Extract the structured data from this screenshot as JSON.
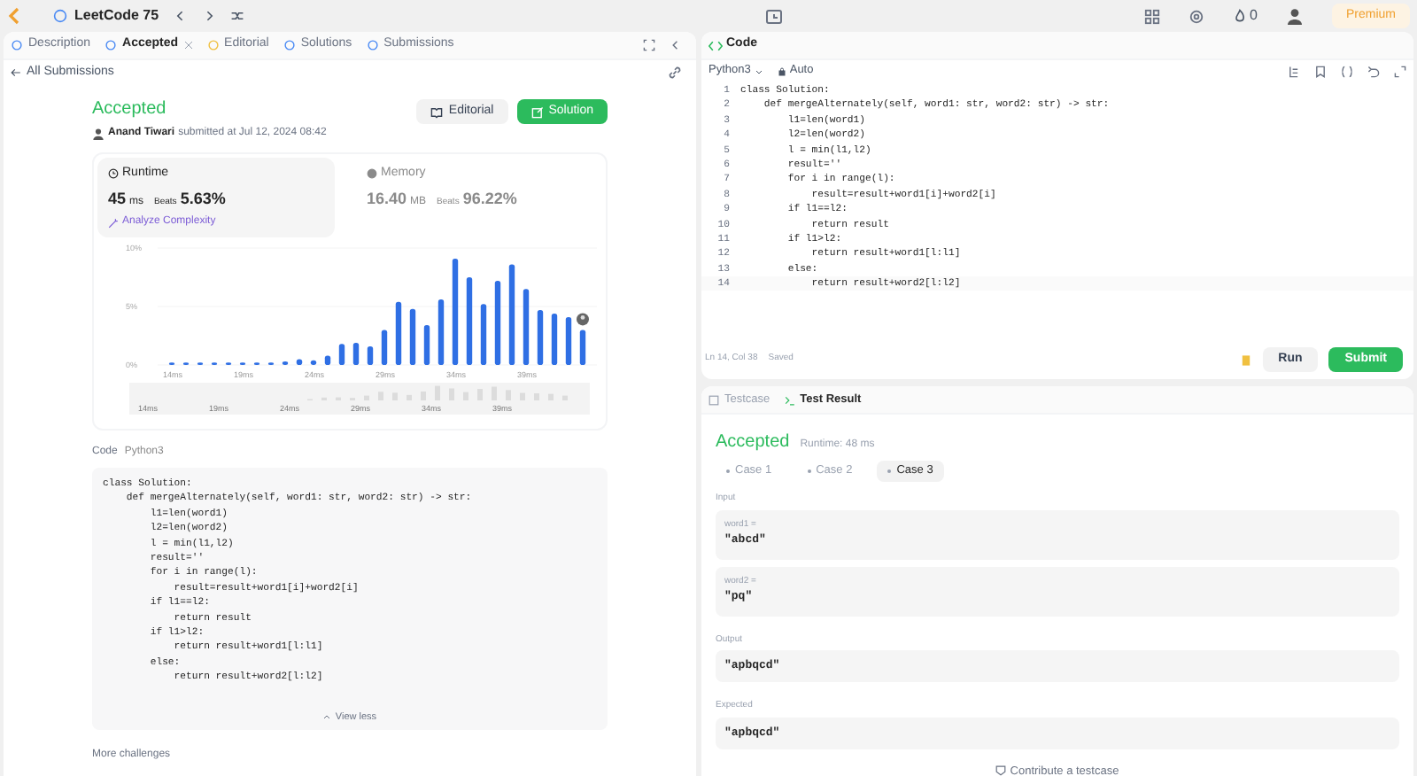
{
  "top_bar": {
    "title": "LeetCode 75",
    "streak": "0",
    "premium": "Premium"
  },
  "left_tabs": [
    {
      "label": "Description",
      "selected": false,
      "closable": false
    },
    {
      "label": "Accepted",
      "selected": true,
      "closable": true
    },
    {
      "label": "Editorial",
      "selected": false,
      "closable": false
    },
    {
      "label": "Solutions",
      "selected": false,
      "closable": false
    },
    {
      "label": "Submissions",
      "selected": false,
      "closable": false
    }
  ],
  "back_link": "All Submissions",
  "submission": {
    "status": "Accepted",
    "author": "Anand Tiwari",
    "submitted": "submitted at Jul 12, 2024 08:42",
    "editorial_button": "Editorial",
    "solution_button": "Solution"
  },
  "stats": [
    {
      "label": "Runtime",
      "value": "45",
      "unit": "ms",
      "beats_label": "Beats",
      "beats": "5.63%",
      "selected": true,
      "link": "Analyze Complexity"
    },
    {
      "label": "Memory",
      "value": "16.40",
      "unit": "MB",
      "beats_label": "Beats",
      "beats": "96.22%",
      "selected": false
    }
  ],
  "chart_data": {
    "type": "bar",
    "x": [
      14,
      15,
      16,
      17,
      18,
      19,
      20,
      21,
      22,
      23,
      24,
      25,
      26,
      27,
      28,
      29,
      30,
      31,
      32,
      33,
      34,
      35,
      36,
      37,
      38,
      39,
      40,
      41,
      42,
      43
    ],
    "series": [
      {
        "color": "#2f6fe4",
        "values": [
          0.2,
          0.2,
          0.2,
          0.2,
          0.2,
          0.2,
          0.2,
          0.2,
          0.3,
          0.5,
          0.4,
          0.8,
          1.8,
          1.9,
          1.6,
          3.0,
          5.4,
          4.8,
          3.4,
          5.6,
          9.1,
          7.5,
          5.2,
          7.2,
          8.6,
          6.5,
          4.7,
          4.4,
          4.1,
          3.0
        ]
      }
    ],
    "ylim": [
      0,
      10
    ],
    "yticks": [
      {
        "value": 0,
        "label": "0%"
      },
      {
        "value": 5,
        "label": "5%"
      },
      {
        "value": 10,
        "label": "10%"
      }
    ],
    "xlim": [
      13,
      44
    ],
    "xticks": [
      {
        "value": 14,
        "label": "14ms"
      },
      {
        "value": 19,
        "label": "19ms"
      },
      {
        "value": 24,
        "label": "24ms"
      },
      {
        "value": 29,
        "label": "29ms"
      },
      {
        "value": 34,
        "label": "34ms"
      },
      {
        "value": 39,
        "label": "39ms"
      }
    ]
  },
  "range_selector": {
    "labels": [
      "14ms",
      "19ms",
      "24ms",
      "29ms",
      "34ms",
      "39ms"
    ]
  },
  "code_section": {
    "label": "Code",
    "language": "Python3",
    "toggle": "View less",
    "lines": [
      "class Solution:",
      "    def mergeAlternately(self, word1: str, word2: str) -> str:",
      "        l1=len(word1)",
      "        l2=len(word2)",
      "        l = min(l1,l2)",
      "        result=''",
      "        for i in range(l):",
      "            result=result+word1[i]+word2[i]",
      "        if l1==l2:",
      "            return result",
      "        if l1>l2:",
      "            return result+word1[l:l1]",
      "        else:",
      "            return result+word2[l:l2]"
    ]
  },
  "more": "More challenges",
  "editor": {
    "title": "Code",
    "language": "Python3",
    "mode": "Auto",
    "status": "Ln 14, Col 38",
    "saved": "Saved",
    "run": "Run",
    "submit": "Submit",
    "lines": [
      {
        "number": "1",
        "text": "class Solution:"
      },
      {
        "number": "2",
        "text": "    def mergeAlternately(self, word1: str, word2: str) -> str:"
      },
      {
        "number": "3",
        "text": "        l1=len(word1)"
      },
      {
        "number": "4",
        "text": "        l2=len(word2)"
      },
      {
        "number": "5",
        "text": "        l = min(l1,l2)"
      },
      {
        "number": "6",
        "text": "        result=''"
      },
      {
        "number": "7",
        "text": "        for i in range(l):"
      },
      {
        "number": "8",
        "text": "            result=result+word1[i]+word2[i]"
      },
      {
        "number": "9",
        "text": "        if l1==l2:"
      },
      {
        "number": "10",
        "text": "            return result"
      },
      {
        "number": "11",
        "text": "        if l1>l2:"
      },
      {
        "number": "12",
        "text": "            return result+word1[l:l1]"
      },
      {
        "number": "13",
        "text": "        else:"
      },
      {
        "number": "14",
        "text": "            return result+word2[l:l2]"
      }
    ]
  },
  "result_tabs": [
    {
      "label": "Testcase",
      "selected": false
    },
    {
      "label": "Test Result",
      "selected": true
    }
  ],
  "result": {
    "status": "Accepted",
    "runtime": "Runtime: 48 ms",
    "cases": [
      {
        "label": "Case 1",
        "selected": false
      },
      {
        "label": "Case 2",
        "selected": false
      },
      {
        "label": "Case 3",
        "selected": true
      }
    ],
    "sections": [
      {
        "label": "Input",
        "fields": [
          {
            "name": "word1 =",
            "value": "\"abcd\""
          },
          {
            "name": "word2 =",
            "value": "\"pq\""
          }
        ]
      },
      {
        "label": "Output",
        "fields": [
          {
            "value": "\"apbqcd\""
          }
        ]
      },
      {
        "label": "Expected",
        "fields": [
          {
            "value": "\"apbqcd\""
          }
        ]
      }
    ],
    "contribute": "Contribute a testcase"
  }
}
